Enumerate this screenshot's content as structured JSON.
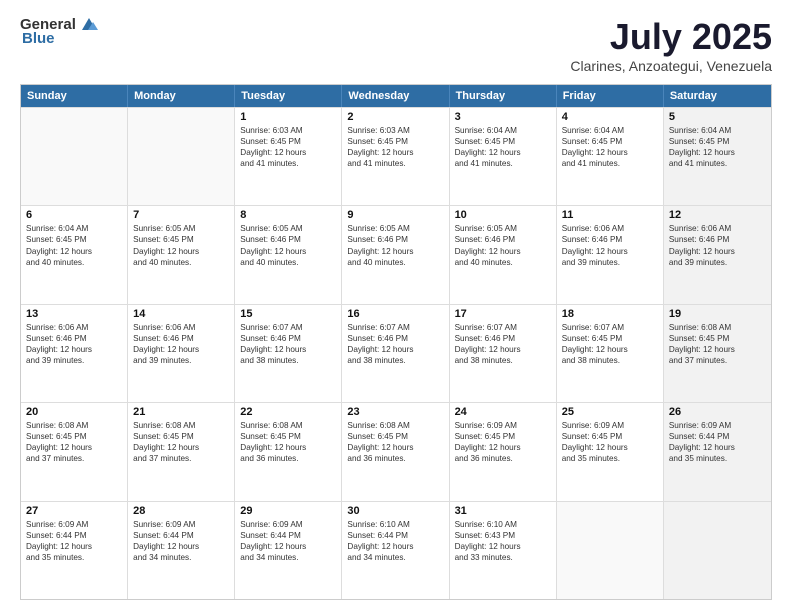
{
  "logo": {
    "general": "General",
    "blue": "Blue"
  },
  "header": {
    "month": "July 2025",
    "location": "Clarines, Anzoategui, Venezuela"
  },
  "days_of_week": [
    "Sunday",
    "Monday",
    "Tuesday",
    "Wednesday",
    "Thursday",
    "Friday",
    "Saturday"
  ],
  "weeks": [
    [
      {
        "day": "",
        "empty": true
      },
      {
        "day": "",
        "empty": true
      },
      {
        "day": "1",
        "line1": "Sunrise: 6:03 AM",
        "line2": "Sunset: 6:45 PM",
        "line3": "Daylight: 12 hours",
        "line4": "and 41 minutes."
      },
      {
        "day": "2",
        "line1": "Sunrise: 6:03 AM",
        "line2": "Sunset: 6:45 PM",
        "line3": "Daylight: 12 hours",
        "line4": "and 41 minutes."
      },
      {
        "day": "3",
        "line1": "Sunrise: 6:04 AM",
        "line2": "Sunset: 6:45 PM",
        "line3": "Daylight: 12 hours",
        "line4": "and 41 minutes."
      },
      {
        "day": "4",
        "line1": "Sunrise: 6:04 AM",
        "line2": "Sunset: 6:45 PM",
        "line3": "Daylight: 12 hours",
        "line4": "and 41 minutes."
      },
      {
        "day": "5",
        "line1": "Sunrise: 6:04 AM",
        "line2": "Sunset: 6:45 PM",
        "line3": "Daylight: 12 hours",
        "line4": "and 41 minutes.",
        "shaded": true
      }
    ],
    [
      {
        "day": "6",
        "line1": "Sunrise: 6:04 AM",
        "line2": "Sunset: 6:45 PM",
        "line3": "Daylight: 12 hours",
        "line4": "and 40 minutes."
      },
      {
        "day": "7",
        "line1": "Sunrise: 6:05 AM",
        "line2": "Sunset: 6:45 PM",
        "line3": "Daylight: 12 hours",
        "line4": "and 40 minutes."
      },
      {
        "day": "8",
        "line1": "Sunrise: 6:05 AM",
        "line2": "Sunset: 6:46 PM",
        "line3": "Daylight: 12 hours",
        "line4": "and 40 minutes."
      },
      {
        "day": "9",
        "line1": "Sunrise: 6:05 AM",
        "line2": "Sunset: 6:46 PM",
        "line3": "Daylight: 12 hours",
        "line4": "and 40 minutes."
      },
      {
        "day": "10",
        "line1": "Sunrise: 6:05 AM",
        "line2": "Sunset: 6:46 PM",
        "line3": "Daylight: 12 hours",
        "line4": "and 40 minutes."
      },
      {
        "day": "11",
        "line1": "Sunrise: 6:06 AM",
        "line2": "Sunset: 6:46 PM",
        "line3": "Daylight: 12 hours",
        "line4": "and 39 minutes."
      },
      {
        "day": "12",
        "line1": "Sunrise: 6:06 AM",
        "line2": "Sunset: 6:46 PM",
        "line3": "Daylight: 12 hours",
        "line4": "and 39 minutes.",
        "shaded": true
      }
    ],
    [
      {
        "day": "13",
        "line1": "Sunrise: 6:06 AM",
        "line2": "Sunset: 6:46 PM",
        "line3": "Daylight: 12 hours",
        "line4": "and 39 minutes."
      },
      {
        "day": "14",
        "line1": "Sunrise: 6:06 AM",
        "line2": "Sunset: 6:46 PM",
        "line3": "Daylight: 12 hours",
        "line4": "and 39 minutes."
      },
      {
        "day": "15",
        "line1": "Sunrise: 6:07 AM",
        "line2": "Sunset: 6:46 PM",
        "line3": "Daylight: 12 hours",
        "line4": "and 38 minutes."
      },
      {
        "day": "16",
        "line1": "Sunrise: 6:07 AM",
        "line2": "Sunset: 6:46 PM",
        "line3": "Daylight: 12 hours",
        "line4": "and 38 minutes."
      },
      {
        "day": "17",
        "line1": "Sunrise: 6:07 AM",
        "line2": "Sunset: 6:46 PM",
        "line3": "Daylight: 12 hours",
        "line4": "and 38 minutes."
      },
      {
        "day": "18",
        "line1": "Sunrise: 6:07 AM",
        "line2": "Sunset: 6:45 PM",
        "line3": "Daylight: 12 hours",
        "line4": "and 38 minutes."
      },
      {
        "day": "19",
        "line1": "Sunrise: 6:08 AM",
        "line2": "Sunset: 6:45 PM",
        "line3": "Daylight: 12 hours",
        "line4": "and 37 minutes.",
        "shaded": true
      }
    ],
    [
      {
        "day": "20",
        "line1": "Sunrise: 6:08 AM",
        "line2": "Sunset: 6:45 PM",
        "line3": "Daylight: 12 hours",
        "line4": "and 37 minutes."
      },
      {
        "day": "21",
        "line1": "Sunrise: 6:08 AM",
        "line2": "Sunset: 6:45 PM",
        "line3": "Daylight: 12 hours",
        "line4": "and 37 minutes."
      },
      {
        "day": "22",
        "line1": "Sunrise: 6:08 AM",
        "line2": "Sunset: 6:45 PM",
        "line3": "Daylight: 12 hours",
        "line4": "and 36 minutes."
      },
      {
        "day": "23",
        "line1": "Sunrise: 6:08 AM",
        "line2": "Sunset: 6:45 PM",
        "line3": "Daylight: 12 hours",
        "line4": "and 36 minutes."
      },
      {
        "day": "24",
        "line1": "Sunrise: 6:09 AM",
        "line2": "Sunset: 6:45 PM",
        "line3": "Daylight: 12 hours",
        "line4": "and 36 minutes."
      },
      {
        "day": "25",
        "line1": "Sunrise: 6:09 AM",
        "line2": "Sunset: 6:45 PM",
        "line3": "Daylight: 12 hours",
        "line4": "and 35 minutes."
      },
      {
        "day": "26",
        "line1": "Sunrise: 6:09 AM",
        "line2": "Sunset: 6:44 PM",
        "line3": "Daylight: 12 hours",
        "line4": "and 35 minutes.",
        "shaded": true
      }
    ],
    [
      {
        "day": "27",
        "line1": "Sunrise: 6:09 AM",
        "line2": "Sunset: 6:44 PM",
        "line3": "Daylight: 12 hours",
        "line4": "and 35 minutes."
      },
      {
        "day": "28",
        "line1": "Sunrise: 6:09 AM",
        "line2": "Sunset: 6:44 PM",
        "line3": "Daylight: 12 hours",
        "line4": "and 34 minutes."
      },
      {
        "day": "29",
        "line1": "Sunrise: 6:09 AM",
        "line2": "Sunset: 6:44 PM",
        "line3": "Daylight: 12 hours",
        "line4": "and 34 minutes."
      },
      {
        "day": "30",
        "line1": "Sunrise: 6:10 AM",
        "line2": "Sunset: 6:44 PM",
        "line3": "Daylight: 12 hours",
        "line4": "and 34 minutes."
      },
      {
        "day": "31",
        "line1": "Sunrise: 6:10 AM",
        "line2": "Sunset: 6:43 PM",
        "line3": "Daylight: 12 hours",
        "line4": "and 33 minutes."
      },
      {
        "day": "",
        "empty": true
      },
      {
        "day": "",
        "empty": true,
        "shaded": true
      }
    ]
  ]
}
